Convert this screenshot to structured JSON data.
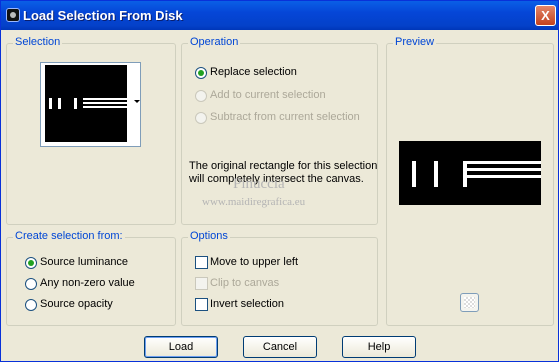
{
  "window": {
    "title": "Load Selection From Disk",
    "close_label": "X"
  },
  "selection": {
    "label": "Selection"
  },
  "operation": {
    "label": "Operation",
    "options": [
      {
        "label": "Replace selection",
        "selected": true,
        "enabled": true
      },
      {
        "label": "Add to current selection",
        "selected": false,
        "enabled": false
      },
      {
        "label": "Subtract from current selection",
        "selected": false,
        "enabled": false
      }
    ],
    "info": "The original rectangle for this selection will completely intersect the canvas."
  },
  "preview": {
    "label": "Preview"
  },
  "create_from": {
    "label": "Create selection from:",
    "options": [
      {
        "label": "Source luminance",
        "selected": true
      },
      {
        "label": "Any non-zero value",
        "selected": false
      },
      {
        "label": "Source opacity",
        "selected": false
      }
    ]
  },
  "options": {
    "label": "Options",
    "items": [
      {
        "label": "Move to upper left",
        "checked": false,
        "enabled": true
      },
      {
        "label": "Clip to canvas",
        "checked": false,
        "enabled": false
      },
      {
        "label": "Invert selection",
        "checked": false,
        "enabled": true
      }
    ]
  },
  "buttons": {
    "load": "Load",
    "cancel": "Cancel",
    "help": "Help"
  },
  "watermark": {
    "name": "Pinuccia",
    "url": "www.maidiregrafica.eu"
  }
}
